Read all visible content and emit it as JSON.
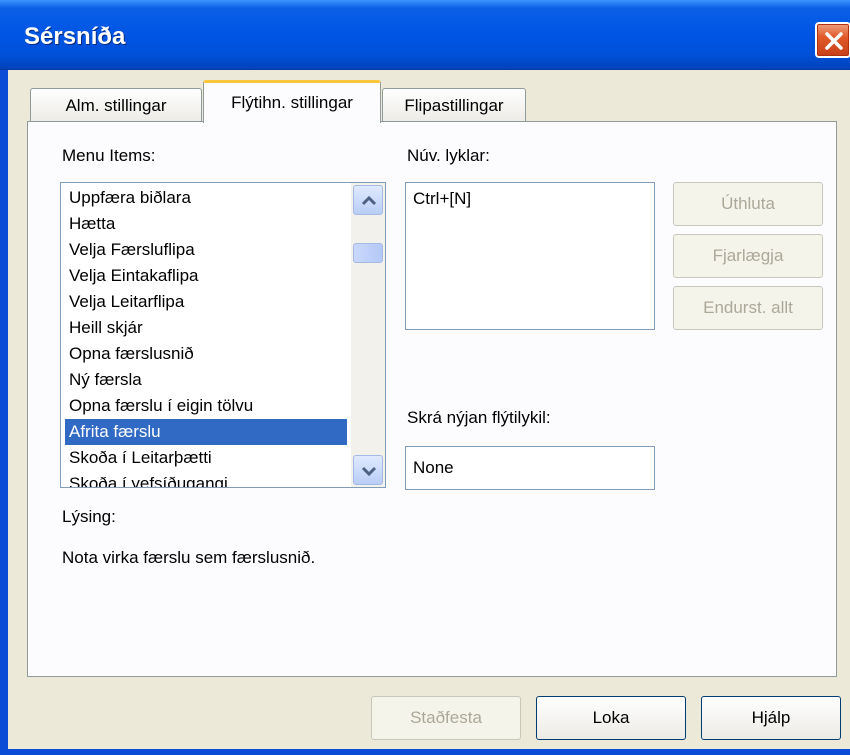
{
  "window": {
    "title": "Sérsníða"
  },
  "tabs": [
    {
      "label": "Alm. stillingar"
    },
    {
      "label": "Flýtihn. stillingar"
    },
    {
      "label": "Flipastillingar"
    }
  ],
  "menu_items_label": "Menu Items:",
  "menu_items": [
    "Uppfæra biðlara",
    "Hætta",
    "Velja Færsluflipa",
    "Velja Eintakaflipa",
    "Velja Leitarflipa",
    "Heill skjár",
    "Opna færslusnið",
    "Ný færsla",
    "Opna færslu í eigin tölvu",
    "Afrita færslu",
    "Skoða í Leitarþætti",
    "Skoða í yefsíðugangi"
  ],
  "selected_item": "Afrita færslu",
  "current_keys_label": "Núv. lyklar:",
  "current_keys_value": "Ctrl+[N]",
  "new_shortcut_label": "Skrá nýjan flýtilykil:",
  "new_shortcut_value": "None",
  "description_label": "Lýsing:",
  "description_text": "Nota virka færslu sem færslusnið.",
  "side_buttons": {
    "assign": "Úthluta",
    "remove": "Fjarlægja",
    "reset_all": "Endurst. allt"
  },
  "footer_buttons": {
    "confirm": "Staðfesta",
    "close": "Loka",
    "help": "Hjálp"
  }
}
